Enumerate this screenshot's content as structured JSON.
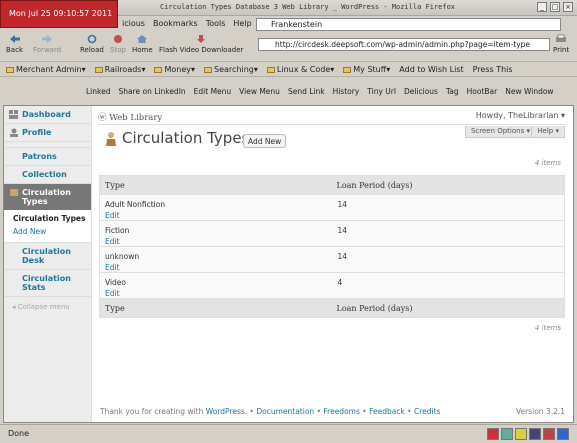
{
  "clock": "Mon Jul 25 09:10:57 2011",
  "window": {
    "title": "Circulation Types Database  3 Web Library  _ WordPress - Mozilla Firefox"
  },
  "menu": [
    "icious",
    "Bookmarks",
    "Tools",
    "Help"
  ],
  "search": {
    "value": "Frankenstein"
  },
  "nav": {
    "back": "Back",
    "forward": "Forward",
    "reload": "Reload",
    "stop": "Stop",
    "home": "Home",
    "flash": "Flash Video Downloader",
    "print": "Print",
    "url": "http://circdesk.deepsoft.com/wp-admin/admin.php?page=item-type"
  },
  "bookmarks": [
    "Merchant Admin",
    "Railroads",
    "Money",
    "Searching",
    "Linux & Code",
    "My Stuff",
    "Add to Wish List",
    "Press This"
  ],
  "toolbar2": [
    "Linked",
    "Share on LinkedIn",
    "Edit Menu",
    "View Menu",
    "Send Link",
    "History",
    "Tiny Url",
    "Delicious",
    "Tag",
    "HootBar",
    "New Window"
  ],
  "sidebar": {
    "dashboard": "Dashboard",
    "profile": "Profile",
    "patrons": "Patrons",
    "collection": "Collection",
    "circ_types": "Circulation Types",
    "sub_current": "Circulation Types",
    "sub_add": "Add New",
    "circ_desk": "Circulation Desk",
    "circ_stats": "Circulation Stats",
    "collapse": "Collapse menu"
  },
  "header": {
    "site": "Web Library",
    "howdy": "Howdy, TheLibrarian",
    "screen_options": "Screen Options",
    "help": "Help"
  },
  "page": {
    "title": "Circulation Types",
    "add_new": "Add New",
    "count_top": "4 items",
    "count_bottom": "4 items"
  },
  "table": {
    "col_type": "Type",
    "col_loan": "Loan Period (days)",
    "edit_label": "Edit",
    "rows": [
      {
        "type": "Adult Nonfiction",
        "loan": "14"
      },
      {
        "type": "Fiction",
        "loan": "14"
      },
      {
        "type": "unknown",
        "loan": "14"
      },
      {
        "type": "Video",
        "loan": "4"
      }
    ]
  },
  "footer": {
    "thanks": "Thank you for creating with",
    "wordpress": "WordPress",
    "documentation": "Documentation",
    "freedoms": "Freedoms",
    "feedback": "Feedback",
    "credits": "Credits",
    "version": "Version 3.2.1"
  },
  "status": "Done"
}
